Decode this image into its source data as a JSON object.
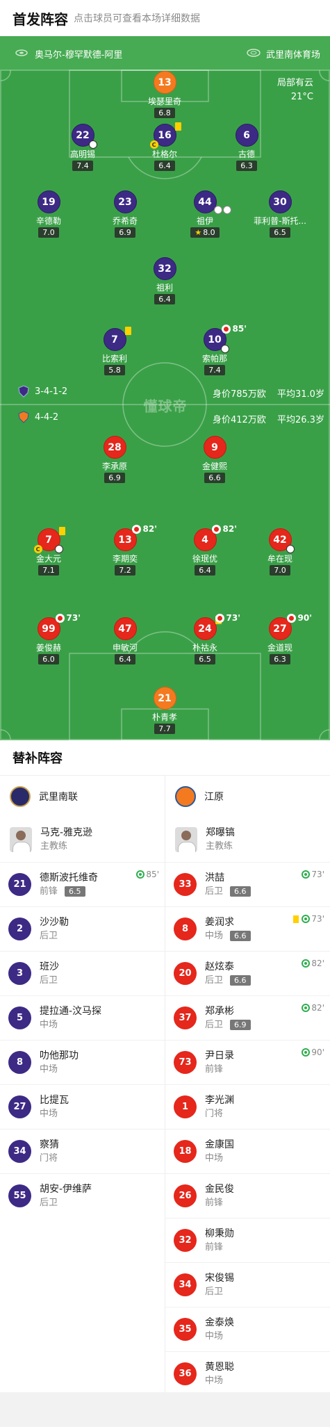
{
  "header": {
    "title": "首发阵容",
    "subtitle": "点击球员可查看本场详细数据"
  },
  "match": {
    "home_team": "奥马尔-穆罕默德-阿里",
    "stadium": "武里南体育场",
    "weather": "局部有云",
    "temperature": "21°C",
    "watermark": "懂球帝"
  },
  "home_info": {
    "formation": "3-4-1-2",
    "value": "身价785万欧",
    "age": "平均31.0岁"
  },
  "away_info": {
    "formation": "4-4-2",
    "value": "身价412万欧",
    "age": "平均26.3岁"
  },
  "home_players": [
    {
      "num": "13",
      "name": "埃瑟里奇",
      "rating": "6.8"
    },
    {
      "num": "22",
      "name": "高明锡",
      "rating": "7.4"
    },
    {
      "num": "16",
      "name": "杜格尔",
      "rating": "6.4"
    },
    {
      "num": "6",
      "name": "古德",
      "rating": "6.3"
    },
    {
      "num": "19",
      "name": "辛德勒",
      "rating": "7.0"
    },
    {
      "num": "23",
      "name": "乔希奇",
      "rating": "6.9"
    },
    {
      "num": "44",
      "name": "祖伊",
      "rating": "8.0"
    },
    {
      "num": "30",
      "name": "菲利普-斯托...",
      "rating": "6.5"
    },
    {
      "num": "32",
      "name": "祖利",
      "rating": "6.4"
    },
    {
      "num": "7",
      "name": "比索利",
      "rating": "5.8"
    },
    {
      "num": "10",
      "name": "索帕那",
      "rating": "7.4",
      "sub_time": "85'"
    }
  ],
  "away_players": [
    {
      "num": "28",
      "name": "李承原",
      "rating": "6.9"
    },
    {
      "num": "9",
      "name": "金健熙",
      "rating": "6.6"
    },
    {
      "num": "7",
      "name": "金大元",
      "rating": "7.1"
    },
    {
      "num": "13",
      "name": "李期奕",
      "rating": "7.2",
      "sub_time": "82'"
    },
    {
      "num": "4",
      "name": "徐珉优",
      "rating": "6.4",
      "sub_time": "82'"
    },
    {
      "num": "42",
      "name": "牟在现",
      "rating": "7.0"
    },
    {
      "num": "99",
      "name": "姜俊赫",
      "rating": "6.0",
      "sub_time": "73'"
    },
    {
      "num": "47",
      "name": "申敏河",
      "rating": "6.4"
    },
    {
      "num": "24",
      "name": "朴祜永",
      "rating": "6.5",
      "sub_time": "73'"
    },
    {
      "num": "27",
      "name": "金道现",
      "rating": "6.3",
      "sub_time": "90'"
    },
    {
      "num": "21",
      "name": "朴青孝",
      "rating": "7.7"
    }
  ],
  "bench": {
    "title": "替补阵容",
    "home": {
      "team": "武里南联",
      "coach": "马克-雅克逊",
      "coach_role": "主教练",
      "players": [
        {
          "num": "21",
          "name": "德斯波托维奇",
          "pos": "前锋",
          "rating": "6.5",
          "sub": "85'"
        },
        {
          "num": "2",
          "name": "沙沙勒",
          "pos": "后卫"
        },
        {
          "num": "3",
          "name": "班沙",
          "pos": "后卫"
        },
        {
          "num": "5",
          "name": "提拉通-汶马探",
          "pos": "中场"
        },
        {
          "num": "8",
          "name": "叻他那功",
          "pos": "中场"
        },
        {
          "num": "27",
          "name": "比提瓦",
          "pos": "中场"
        },
        {
          "num": "34",
          "name": "察猜",
          "pos": "门将"
        },
        {
          "num": "55",
          "name": "胡安-伊维萨",
          "pos": "后卫"
        }
      ]
    },
    "away": {
      "team": "江原",
      "coach": "郑曝镐",
      "coach_role": "主教练",
      "players": [
        {
          "num": "33",
          "name": "洪喆",
          "pos": "后卫",
          "rating": "6.6",
          "sub": "73'"
        },
        {
          "num": "8",
          "name": "姜润求",
          "pos": "中场",
          "rating": "6.6",
          "sub": "73'",
          "card": "yellow"
        },
        {
          "num": "20",
          "name": "赵炫泰",
          "pos": "后卫",
          "rating": "6.6",
          "sub": "82'"
        },
        {
          "num": "37",
          "name": "郑承彬",
          "pos": "后卫",
          "rating": "6.9",
          "sub": "82'"
        },
        {
          "num": "73",
          "name": "尹日录",
          "pos": "前锋",
          "sub": "90'"
        },
        {
          "num": "1",
          "name": "李光渊",
          "pos": "门将"
        },
        {
          "num": "18",
          "name": "金康国",
          "pos": "中场"
        },
        {
          "num": "26",
          "name": "金民俊",
          "pos": "前锋"
        },
        {
          "num": "32",
          "name": "柳秉勋",
          "pos": "前锋"
        },
        {
          "num": "34",
          "name": "宋俊锡",
          "pos": "后卫"
        },
        {
          "num": "35",
          "name": "金泰焕",
          "pos": "中场"
        },
        {
          "num": "36",
          "name": "黄恩聪",
          "pos": "中场"
        }
      ]
    }
  },
  "colors": {
    "pitch": "#3aa048",
    "home": "#3d2a85",
    "away": "#e5271c",
    "keeper_home": "#f47a20",
    "keeper_away": "#f47a20"
  }
}
